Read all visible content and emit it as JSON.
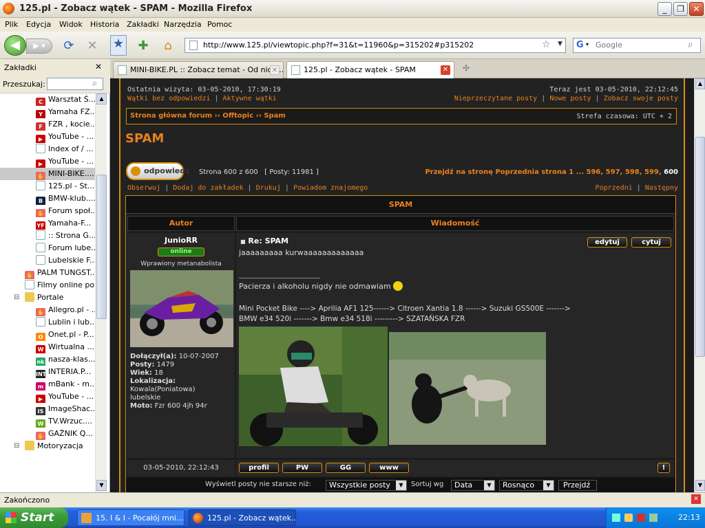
{
  "window": {
    "title": "125.pl - Zobacz wątek - SPAM - Mozilla Firefox",
    "min": "_",
    "max": "❐",
    "close": "✕"
  },
  "menu": [
    "Plik",
    "Edycja",
    "Widok",
    "Historia",
    "Zakładki",
    "Narzędzia",
    "Pomoc"
  ],
  "nav": {
    "url": "http://www.125.pl/viewtopic.php?f=31&t=11960&p=315202#p315202",
    "search_placeholder": "Google"
  },
  "sidebar": {
    "title": "Zakładki",
    "close": "✕",
    "search_label": "Przeszukaj:",
    "items": [
      {
        "label": "Warsztat Ś...",
        "icon": "cgear",
        "color": "#c22",
        "indent": 52
      },
      {
        "label": "Yamaha FZ...",
        "icon": "yamaha",
        "color": "#b00",
        "indent": 52
      },
      {
        "label": "FZR , kocie...",
        "icon": "page-red",
        "color": "#c33",
        "indent": 52
      },
      {
        "label": "YouTube - ...",
        "icon": "youtube",
        "color": "#c00",
        "indent": 52
      },
      {
        "label": "Index of / ...",
        "icon": "page",
        "color": "#888",
        "indent": 52
      },
      {
        "label": "YouTube - ...",
        "icon": "youtube",
        "color": "#c00",
        "indent": 52
      },
      {
        "label": "MINI-BIKE....",
        "icon": "hand",
        "color": "#e66",
        "indent": 52,
        "selected": true
      },
      {
        "label": "125.pl - St...",
        "icon": "page",
        "color": "#888",
        "indent": 52
      },
      {
        "label": "BMW-klub....",
        "icon": "bmw",
        "color": "#124",
        "indent": 52
      },
      {
        "label": "Forum społ...",
        "icon": "hand",
        "color": "#e66",
        "indent": 52
      },
      {
        "label": "Yamaha-F...",
        "icon": "yf",
        "color": "#c00",
        "indent": 52
      },
      {
        "label": ":: Strona G...",
        "icon": "page",
        "color": "#888",
        "indent": 52
      },
      {
        "label": "Forum lube...",
        "icon": "page",
        "color": "#888",
        "indent": 52
      },
      {
        "label": "Lubelskie F...",
        "icon": "page",
        "color": "#888",
        "indent": 52
      },
      {
        "label": "PALM TUNGST...",
        "icon": "hand",
        "color": "#e66",
        "indent": 36
      },
      {
        "label": "Filmy online po...",
        "icon": "page",
        "color": "#888",
        "indent": 36
      },
      {
        "label": "Portale",
        "icon": "folder",
        "color": "#f0c850",
        "indent": 36,
        "folder": true
      },
      {
        "label": "Allegro.pl - ...",
        "icon": "hand",
        "color": "#e66",
        "indent": 52
      },
      {
        "label": "Lublin i lub...",
        "icon": "page",
        "color": "#888",
        "indent": 52
      },
      {
        "label": "Onet.pl - P...",
        "icon": "onet",
        "color": "#f80",
        "indent": 52
      },
      {
        "label": "Wirtualna ...",
        "icon": "wp",
        "color": "#c00",
        "indent": 52
      },
      {
        "label": "nasza-klas...",
        "icon": "nk",
        "color": "#2a6",
        "indent": 52
      },
      {
        "label": "INTERIA.P...",
        "icon": "int",
        "color": "#222",
        "indent": 52
      },
      {
        "label": "mBank - m...",
        "icon": "mbank",
        "color": "#c06",
        "indent": 52
      },
      {
        "label": "YouTube - ...",
        "icon": "youtube",
        "color": "#c00",
        "indent": 52
      },
      {
        "label": "ImageShac...",
        "icon": "imgs",
        "color": "#333",
        "indent": 52
      },
      {
        "label": "TV.Wrzuc....",
        "icon": "wrzuc",
        "color": "#6a2",
        "indent": 52
      },
      {
        "label": "GAŹNIK Q...",
        "icon": "hand",
        "color": "#e66",
        "indent": 52
      },
      {
        "label": "Motoryzacja",
        "icon": "folder",
        "color": "#f0c850",
        "indent": 36,
        "folder": true
      }
    ]
  },
  "tabs": [
    {
      "label": "MINI-BIKE.PL :: Zobacz temat - Od nich...",
      "active": false
    },
    {
      "label": "125.pl - Zobacz wątek - SPAM",
      "active": true
    }
  ],
  "forum": {
    "last_visit": "Ostatnia wizyta: 03-05-2010, 17:30:19",
    "now": "Teraz jest 03-05-2010, 22:12:45",
    "link_unanswered": "Wątki bez odpowiedzi",
    "link_active": "Aktywne wątki",
    "link_unread": "Nieprzeczytane posty",
    "link_new": "Nowe posty",
    "link_own": "Zobacz swoje posty",
    "breadcrumb": "Strona główna forum ›› Offtopic ›› Spam",
    "timezone": "Strefa czasowa: UTC + 2",
    "topic_title": "SPAM",
    "reply_btn": "odpowiedz",
    "page_info": "Strona 600 z 600",
    "posts_count": "[ Posty: 11981 ]",
    "goto_label": "Przejdź na stronę Poprzednia strona  1 ...",
    "pages": [
      "596",
      "597",
      "598",
      "599",
      "600"
    ],
    "actions": [
      "Obserwuj",
      "Dodaj do zakładek",
      "Drukuj",
      "Powiadom znajomego"
    ],
    "prev": "Poprzedni",
    "next": "Następny",
    "table_title": "SPAM",
    "col_author": "Autor",
    "col_message": "Wiadomość"
  },
  "post": {
    "author": "JunioRR",
    "online": "online",
    "rank": "Wprawiony metanabolista",
    "joined_label": "Dołączył(a):",
    "joined": "10-07-2007",
    "posts_label": "Posty:",
    "posts": "1479",
    "age_label": "Wiek:",
    "age": "18",
    "location_label": "Lokalizacja:",
    "location": "Kowala(Poniatowa) lubelskie",
    "moto_label": "Moto:",
    "moto": "Fzr 600 4jh 94r",
    "subject": "Re: SPAM",
    "edit_btn": "edytuj",
    "quote_btn": "cytuj",
    "body": "jaaaaaaaaa kurwaaaaaaaaaaaaa",
    "signature_line1": "Pacierza i alkoholu nigdy nie odmawiam",
    "signature_line2": "Mini Pocket Bike ----> Aprilia AF1 125------> Citroen Xantia 1.8 ------> Suzuki GS500E ------->",
    "signature_line3": "BMW e34 520i -------> Bmw e34 518i ---------> SZATAŃSKA FZR",
    "date": "03-05-2010, 22:12:43",
    "btn_profile": "profil",
    "btn_pm": "PW",
    "btn_gg": "GG",
    "btn_www": "www"
  },
  "filter": {
    "label": "Wyświetl posty nie starsze niż:",
    "all": "Wszystkie posty",
    "sort_label": "Sortuj wg",
    "sort_by": "Data",
    "order": "Rosnąco",
    "go": "Przejdź"
  },
  "status": {
    "text": "Zakończono"
  },
  "taskbar": {
    "start": "Start",
    "tasks": [
      "15. I & I - Pocałój mni...",
      "125.pl - Zobacz wątek..."
    ],
    "clock": "22:13"
  }
}
